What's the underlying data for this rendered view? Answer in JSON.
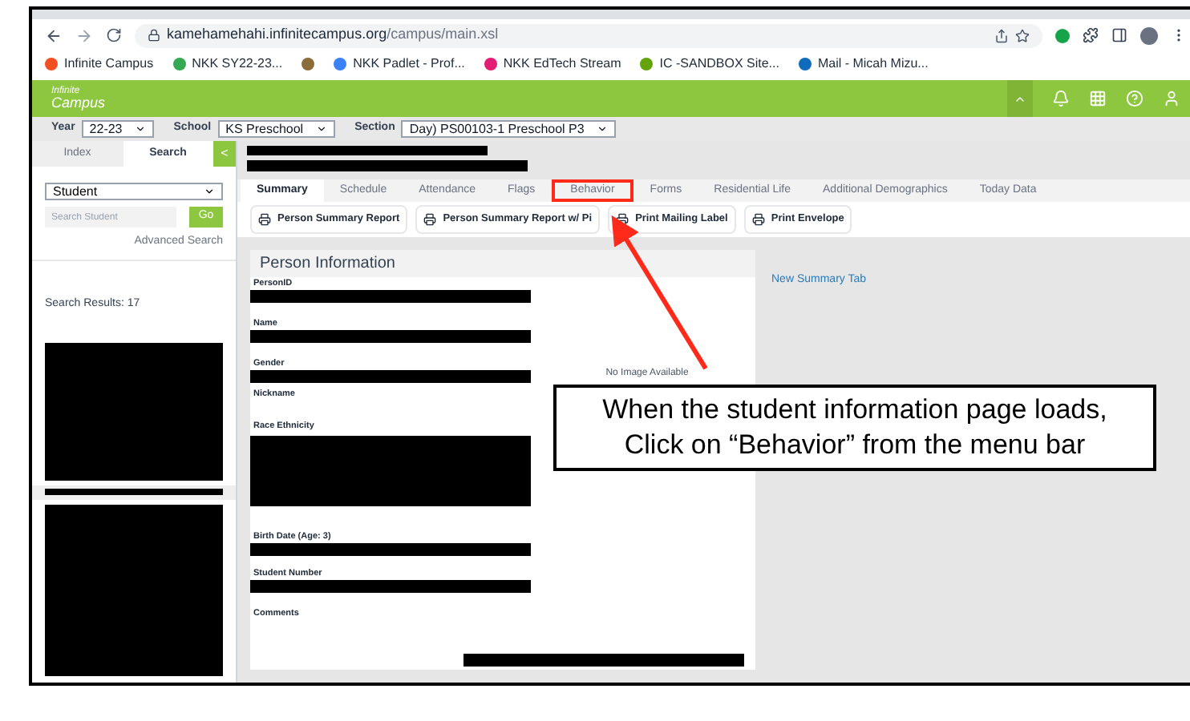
{
  "browser": {
    "url_host": "kamehamehahi.infinitecampus.org",
    "url_path": "/campus/main.xsl",
    "bookmarks": [
      {
        "label": "Infinite Campus",
        "color": "#f25022"
      },
      {
        "label": "NKK SY22-23...",
        "color": "#34a853"
      },
      {
        "color": "#8a6d3b"
      },
      {
        "label": "NKK Padlet - Prof...",
        "color": "#3b82f6"
      },
      {
        "label": "NKK EdTech Stream",
        "color": "#e11d74"
      },
      {
        "label": "IC -SANDBOX Site...",
        "color": "#65a30d"
      },
      {
        "label": "Mail - Micah Mizu...",
        "color": "#0f6cbd"
      }
    ]
  },
  "header": {
    "logo_line1": "Infinite",
    "logo_line2": "Campus"
  },
  "selectors": [
    {
      "label": "Year",
      "value": "22-23"
    },
    {
      "label": "School",
      "value": "KS Preschool"
    },
    {
      "label": "Section",
      "value": "Day) PS00103-1 Preschool P3"
    }
  ],
  "left_panel": {
    "tabs": [
      {
        "label": "Index",
        "selected": false
      },
      {
        "label": "Search",
        "selected": true
      }
    ],
    "collapse": "<",
    "search_type": "Student",
    "search_placeholder": "Search Student",
    "go": "Go",
    "advanced": "Advanced Search",
    "results": "Search Results: 17"
  },
  "tabs": [
    {
      "label": "Summary",
      "selected": true,
      "highlighted": false
    },
    {
      "label": "Schedule",
      "selected": false,
      "highlighted": false
    },
    {
      "label": "Attendance",
      "selected": false,
      "highlighted": false
    },
    {
      "label": "Flags",
      "selected": false,
      "highlighted": false
    },
    {
      "label": "Behavior",
      "selected": false,
      "highlighted": true
    },
    {
      "label": "Forms",
      "selected": false,
      "highlighted": false
    },
    {
      "label": "Residential Life",
      "selected": false,
      "highlighted": false
    },
    {
      "label": "Additional Demographics",
      "selected": false,
      "highlighted": false
    },
    {
      "label": "Today Data",
      "selected": false,
      "highlighted": false
    }
  ],
  "actions": [
    "Person Summary Report",
    "Person Summary Report w/ Pi",
    "Print Mailing Label",
    "Print Envelope"
  ],
  "person_info": {
    "title": "Person Information",
    "fields": [
      "PersonID",
      "Name",
      "Gender",
      "Nickname",
      "Race Ethnicity",
      "Birth Date (Age: 3)",
      "Student Number",
      "Comments"
    ],
    "no_image": "No Image Available"
  },
  "new_summary_link": "New Summary Tab",
  "annotation": {
    "lines": [
      "When the student information page loads,",
      "Click on “Behavior” from the menu bar"
    ]
  }
}
